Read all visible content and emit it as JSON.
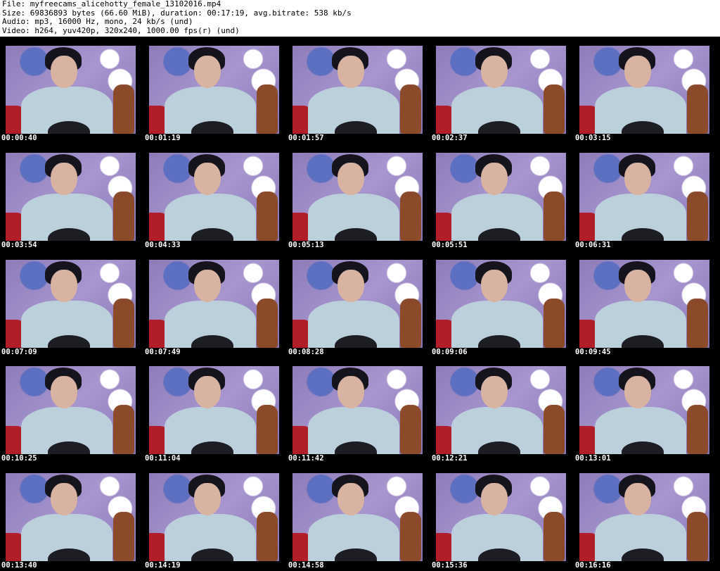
{
  "header": {
    "file": "File: myfreecams_alicehotty_female_13102016.mp4",
    "size": "Size: 69836893 bytes (66.60 MiB), duration: 00:17:19, avg.bitrate: 538 kb/s",
    "audio": "Audio: mp3, 16000 Hz, mono, 24 kb/s (und)",
    "video": "Video: h264, yuv420p, 320x240, 1000.00 fps(r) (und)"
  },
  "thumbnails": [
    {
      "timestamp": "00:00:40"
    },
    {
      "timestamp": "00:01:19"
    },
    {
      "timestamp": "00:01:57"
    },
    {
      "timestamp": "00:02:37"
    },
    {
      "timestamp": "00:03:15"
    },
    {
      "timestamp": "00:03:54"
    },
    {
      "timestamp": "00:04:33"
    },
    {
      "timestamp": "00:05:13"
    },
    {
      "timestamp": "00:05:51"
    },
    {
      "timestamp": "00:06:31"
    },
    {
      "timestamp": "00:07:09"
    },
    {
      "timestamp": "00:07:49"
    },
    {
      "timestamp": "00:08:28"
    },
    {
      "timestamp": "00:09:06"
    },
    {
      "timestamp": "00:09:45"
    },
    {
      "timestamp": "00:10:25"
    },
    {
      "timestamp": "00:11:04"
    },
    {
      "timestamp": "00:11:42"
    },
    {
      "timestamp": "00:12:21"
    },
    {
      "timestamp": "00:13:01"
    },
    {
      "timestamp": "00:13:40"
    },
    {
      "timestamp": "00:14:19"
    },
    {
      "timestamp": "00:14:58"
    },
    {
      "timestamp": "00:15:36"
    },
    {
      "timestamp": "00:16:16"
    }
  ]
}
